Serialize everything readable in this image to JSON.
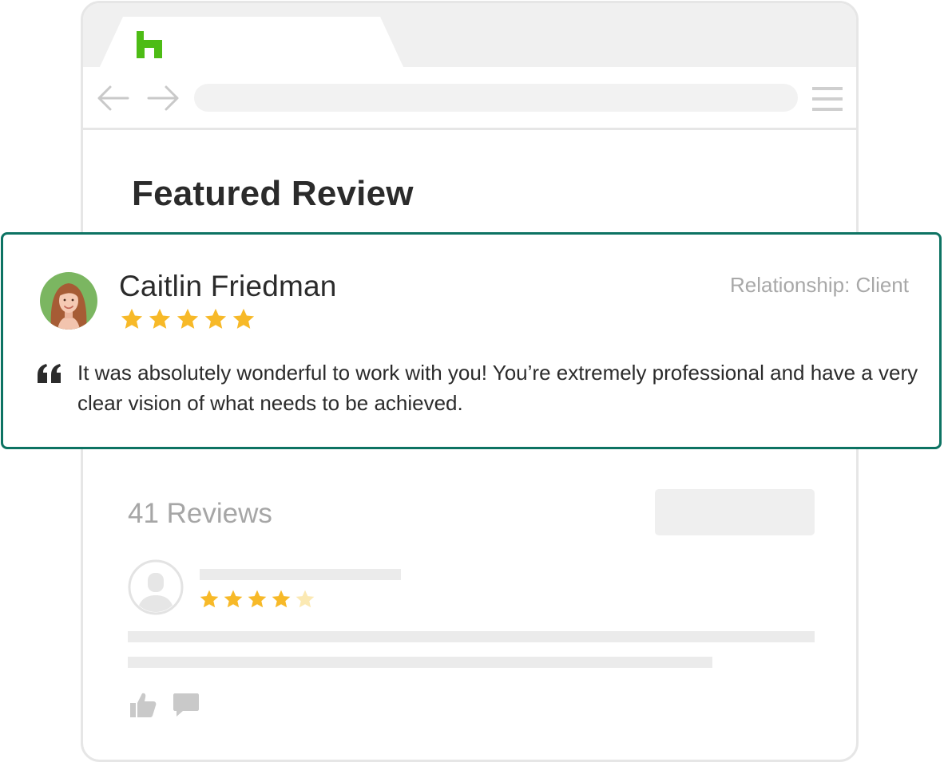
{
  "browser": {
    "logo_icon": "houzz-logo",
    "back_icon": "arrow-left-icon",
    "forward_icon": "arrow-right-icon",
    "menu_icon": "hamburger-menu-icon"
  },
  "page": {
    "title": "Featured Review"
  },
  "featured_review": {
    "reviewer_name": "Caitlin Friedman",
    "relationship": "Relationship: Client",
    "rating": 5,
    "rating_max": 5,
    "quote_icon": "quote-icon",
    "text": "It was absolutely wonderful to work with you! You’re extremely professional and have a very clear vision of what needs to be achieved."
  },
  "reviews": {
    "count_label": "41 Reviews",
    "items": [
      {
        "rating": 4,
        "rating_max": 5,
        "like_icon": "thumbs-up-icon",
        "comment_icon": "comment-icon"
      }
    ]
  },
  "colors": {
    "brand_green": "#4dbc15",
    "card_border": "#0d7363",
    "star_filled": "#f7b928",
    "star_empty": "#fbe9b3",
    "placeholder_gray": "#ebebeb"
  }
}
